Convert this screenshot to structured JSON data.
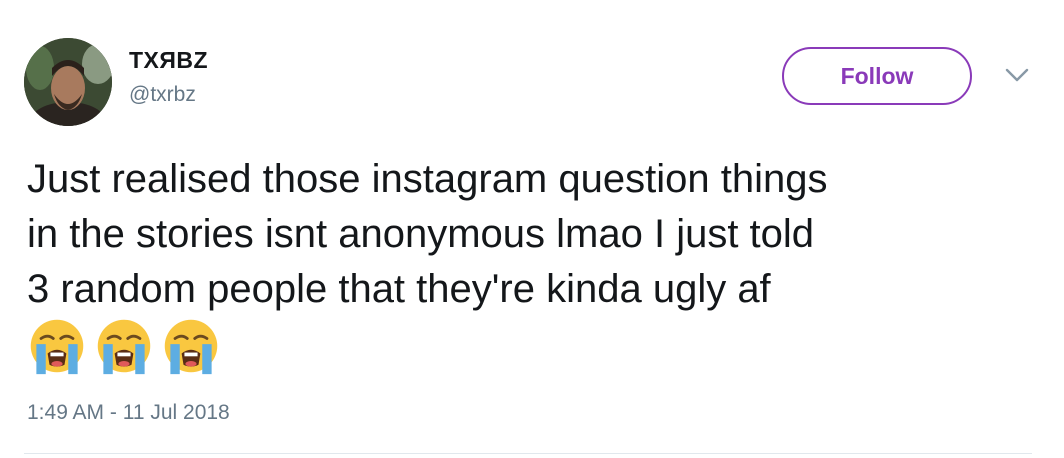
{
  "author": {
    "display_name": "TXЯBZ",
    "handle": "@txrbz"
  },
  "follow_button": {
    "label": "Follow",
    "color": "#8a3ab9"
  },
  "menu": {
    "icon": "chevron-down-icon"
  },
  "tweet": {
    "lines": [
      "Just realised those instagram question things",
      "in the stories isnt anonymous lmao I just told",
      "3 random people that they're kinda ugly af"
    ],
    "emojis": [
      "loudly-crying-face-icon",
      "loudly-crying-face-icon",
      "loudly-crying-face-icon"
    ],
    "timestamp": "1:49 AM - 11 Jul 2018"
  }
}
